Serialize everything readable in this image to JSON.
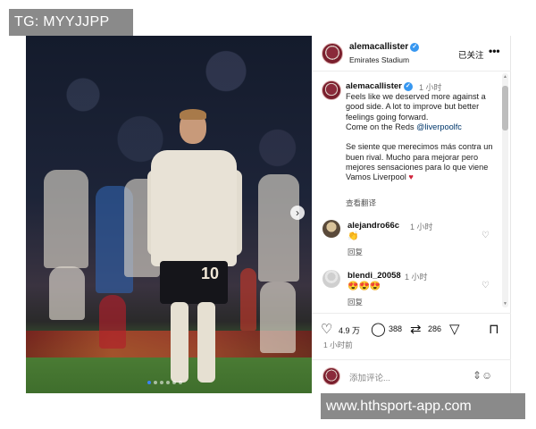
{
  "overlay": {
    "top_left_label": "TG: MYYJJPP",
    "bottom_right_label": "www.hthsport-app.com"
  },
  "post": {
    "author": "alemacallister",
    "location": "Emirates Stadium",
    "follow_label": "已关注",
    "more_label": "•••",
    "photo_jersey_number": "10",
    "carousel": {
      "total": 6,
      "current": 1
    },
    "caption": {
      "author": "alemacallister",
      "time": "1 小时",
      "text_en": "Feels like we deserved more against a good side. A lot to improve but better feelings going forward.\nCome on the Reds ",
      "mention": "@liverpoolfc",
      "text_es": "Se siente que merecimos más contra un buen rival. Mucho para mejorar pero mejores sensaciones para lo que viene\nVamos Liverpool ",
      "heart": "♥",
      "see_translation": "查看翻译"
    },
    "comments": [
      {
        "user": "alejandro66c",
        "time": "1 小时",
        "body": "👏",
        "reply": "回复"
      },
      {
        "user": "blendi_20058",
        "time": "1 小时",
        "body": "😍😍😍",
        "reply": "回复"
      }
    ],
    "actions": {
      "likes": "4.9 万",
      "comments": "388",
      "reposts": "286"
    },
    "posted_time": "1 小时前",
    "add_comment_placeholder": "添加评论..."
  },
  "colors": {
    "verified": "#3797f0",
    "link": "#00376b",
    "heart": "#d0243c",
    "overlay_bg": "#8a8a8a"
  },
  "icons": [
    "verified-icon",
    "more-icon",
    "heart-icon",
    "comment-icon",
    "repost-icon",
    "share-icon",
    "bookmark-icon",
    "emoji-icon",
    "next-arrow-icon"
  ]
}
